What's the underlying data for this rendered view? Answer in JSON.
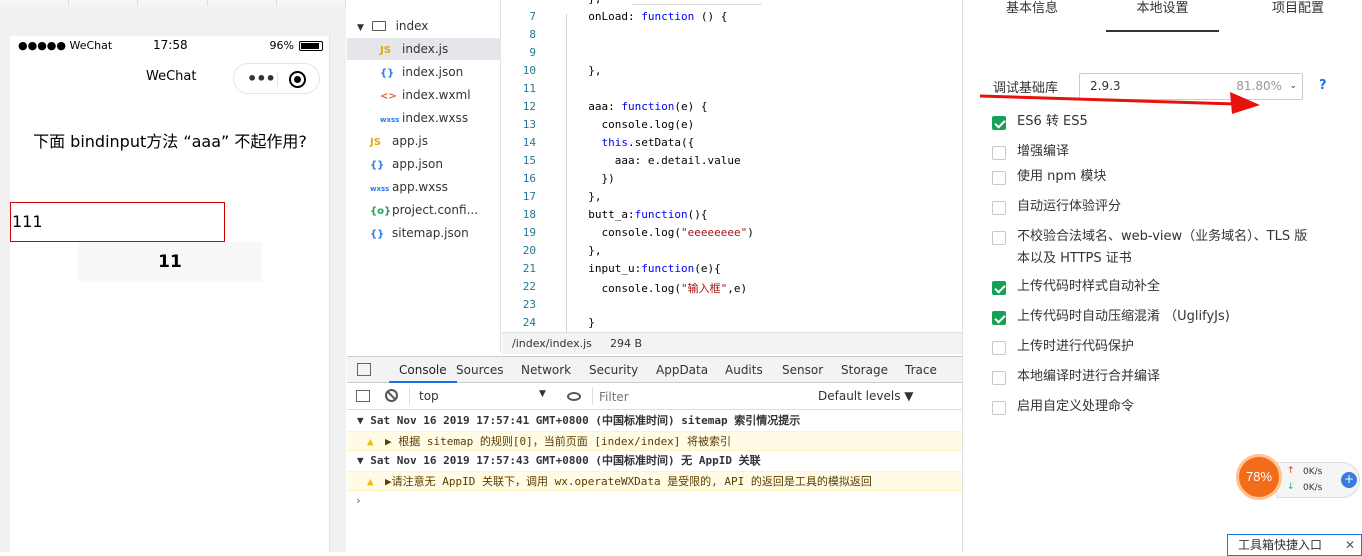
{
  "simulator": {
    "status_left": "●●●●● WeChat",
    "status_time": "17:58",
    "status_battery": "96%",
    "nav_title": "WeChat",
    "question": "下面 bindinput方法 “aaa” 不起作用?",
    "input_value": "111",
    "button_label": "11"
  },
  "file_tree": {
    "folder": "index",
    "items": [
      {
        "icon": "JS",
        "name": "index.js"
      },
      {
        "icon": "{}",
        "name": "index.json"
      },
      {
        "icon": "<>",
        "name": "index.wxml"
      },
      {
        "icon": "wxss",
        "name": "index.wxss"
      },
      {
        "icon": "JS",
        "name": "app.js"
      },
      {
        "icon": "{}",
        "name": "app.json"
      },
      {
        "icon": "wxss",
        "name": "app.wxss"
      },
      {
        "icon": "{o}",
        "name": "project.confi..."
      },
      {
        "icon": "{}",
        "name": "sitemap.json"
      }
    ]
  },
  "editor": {
    "lines": [
      {
        "n": "",
        "t": "  },"
      },
      {
        "n": "7",
        "t": "  onLoad: function () {"
      },
      {
        "n": "8",
        "t": ""
      },
      {
        "n": "9",
        "t": ""
      },
      {
        "n": "10",
        "t": "  },"
      },
      {
        "n": "11",
        "t": ""
      },
      {
        "n": "12",
        "t": "  aaa: function(e) {"
      },
      {
        "n": "13",
        "t": "    console.log(e)"
      },
      {
        "n": "14",
        "t": "    this.setData({"
      },
      {
        "n": "15",
        "t": "      aaa: e.detail.value"
      },
      {
        "n": "16",
        "t": "    })"
      },
      {
        "n": "17",
        "t": "  },"
      },
      {
        "n": "18",
        "t": "  butt_a:function(){"
      },
      {
        "n": "19",
        "t": "    console.log(\"eeeeeeee\")"
      },
      {
        "n": "20",
        "t": "  },"
      },
      {
        "n": "21",
        "t": "  input_u:function(e){"
      },
      {
        "n": "22",
        "t": "    console.log(\"输入框\",e)"
      },
      {
        "n": "23",
        "t": ""
      },
      {
        "n": "24",
        "t": "  }"
      }
    ],
    "path": "/index/index.js",
    "size": "294 B"
  },
  "devtools": {
    "tabs": [
      "Console",
      "Sources",
      "Network",
      "Security",
      "AppData",
      "Audits",
      "Sensor",
      "Storage",
      "Trace"
    ],
    "context": "top",
    "filter_placeholder": "Filter",
    "levels": "Default levels ▼",
    "logs": [
      {
        "type": "group",
        "text": "▼ Sat Nov 16 2019 17:57:41 GMT+0800 (中国标准时间) sitemap 索引情况提示"
      },
      {
        "type": "warn",
        "text": "▶ 根据 sitemap 的规则[0]，当前页面 [index/index] 将被索引"
      },
      {
        "type": "group",
        "text": "▼ Sat Nov 16 2019 17:57:43 GMT+0800 (中国标准时间) 无 AppID 关联"
      },
      {
        "type": "warn",
        "text": "▶请注意无 AppID 关联下，调用 wx.operateWXData 是受限的, API 的返回是工具的模拟返回"
      }
    ],
    "prompt": "›"
  },
  "settings": {
    "tabs": [
      "基本信息",
      "本地设置",
      "项目配置"
    ],
    "lib_label": "调试基础库",
    "lib_version": "2.9.3",
    "lib_percent": "81.80%",
    "help": "?",
    "options": [
      {
        "label": "ES6 转 ES5",
        "checked": true
      },
      {
        "label": "增强编译",
        "checked": false
      },
      {
        "label": "使用 npm 模块",
        "checked": false
      },
      {
        "label": "自动运行体验评分",
        "checked": false
      },
      {
        "label": "不校验合法域名、web-view（业务域名）、TLS 版本以及 HTTPS 证书",
        "checked": false
      },
      {
        "label": "上传代码时样式自动补全",
        "checked": true
      },
      {
        "label": "上传代码时自动压缩混淆 （UglifyJs)",
        "checked": true
      },
      {
        "label": "上传时进行代码保护",
        "checked": false
      },
      {
        "label": "本地编译时进行合并编译",
        "checked": false
      },
      {
        "label": "启用自定义处理命令",
        "checked": false
      }
    ]
  },
  "widget": {
    "percent": "78%",
    "up": "0K/s",
    "down": "0K/s"
  },
  "toolbox": {
    "label": "工具箱快捷入口",
    "close": "✕"
  }
}
